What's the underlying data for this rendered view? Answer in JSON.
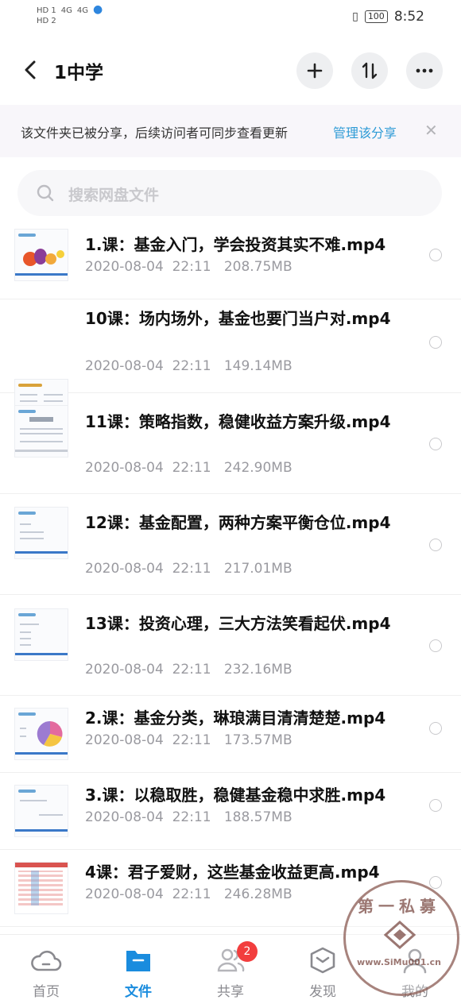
{
  "status": {
    "sim1": "HD 1",
    "sim2": "HD 2",
    "net1": "4G",
    "net2": "4G",
    "battery": "100",
    "time": "8:52"
  },
  "header": {
    "title": "1中学",
    "back_icon": "chevron-left-icon",
    "add_icon": "plus-icon",
    "sort_icon": "sort-icon",
    "more_icon": "more-icon"
  },
  "share_bar": {
    "text": "该文件夹已被分享，后续访问者可同步查看更新",
    "manage": "管理该分享",
    "close": "✕"
  },
  "search": {
    "placeholder": "搜索网盘文件"
  },
  "files": [
    {
      "name": "1.课：基金入门，学会投资其实不难.mp4",
      "date": "2020-08-04",
      "time": "22:11",
      "size": "208.75MB"
    },
    {
      "name": "10课：场内场外，基金也要门当户对.mp4",
      "date": "2020-08-04",
      "time": "22:11",
      "size": "149.14MB"
    },
    {
      "name": "11课：策略指数，稳健收益方案升级.mp4",
      "date": "2020-08-04",
      "time": "22:11",
      "size": "242.90MB"
    },
    {
      "name": "12课：基金配置，两种方案平衡仓位.mp4",
      "date": "2020-08-04",
      "time": "22:11",
      "size": "217.01MB"
    },
    {
      "name": "13课：投资心理，三大方法笑看起伏.mp4",
      "date": "2020-08-04",
      "time": "22:11",
      "size": "232.16MB"
    },
    {
      "name": "2.课：基金分类，琳琅满目清清楚楚.mp4",
      "date": "2020-08-04",
      "time": "22:11",
      "size": "173.57MB"
    },
    {
      "name": "3.课：以稳取胜，稳健基金稳中求胜.mp4",
      "date": "2020-08-04",
      "time": "22:11",
      "size": "188.57MB"
    },
    {
      "name": "4课：君子爱财，这些基金收益更高.mp4",
      "date": "2020-08-04",
      "time": "22:11",
      "size": "246.28MB"
    }
  ],
  "tabs": [
    {
      "label": "首页",
      "icon": "cloud-icon"
    },
    {
      "label": "文件",
      "icon": "folder-icon"
    },
    {
      "label": "共享",
      "icon": "people-icon",
      "badge": "2"
    },
    {
      "label": "发现",
      "icon": "cube-icon"
    },
    {
      "label": "我的",
      "icon": "user-icon"
    }
  ],
  "watermark": {
    "top_text": "第一私募",
    "url": "www.SiMu001.cn"
  },
  "colors": {
    "accent": "#1a8cde",
    "link": "#2e9bd6",
    "badge": "#f23e3e"
  }
}
